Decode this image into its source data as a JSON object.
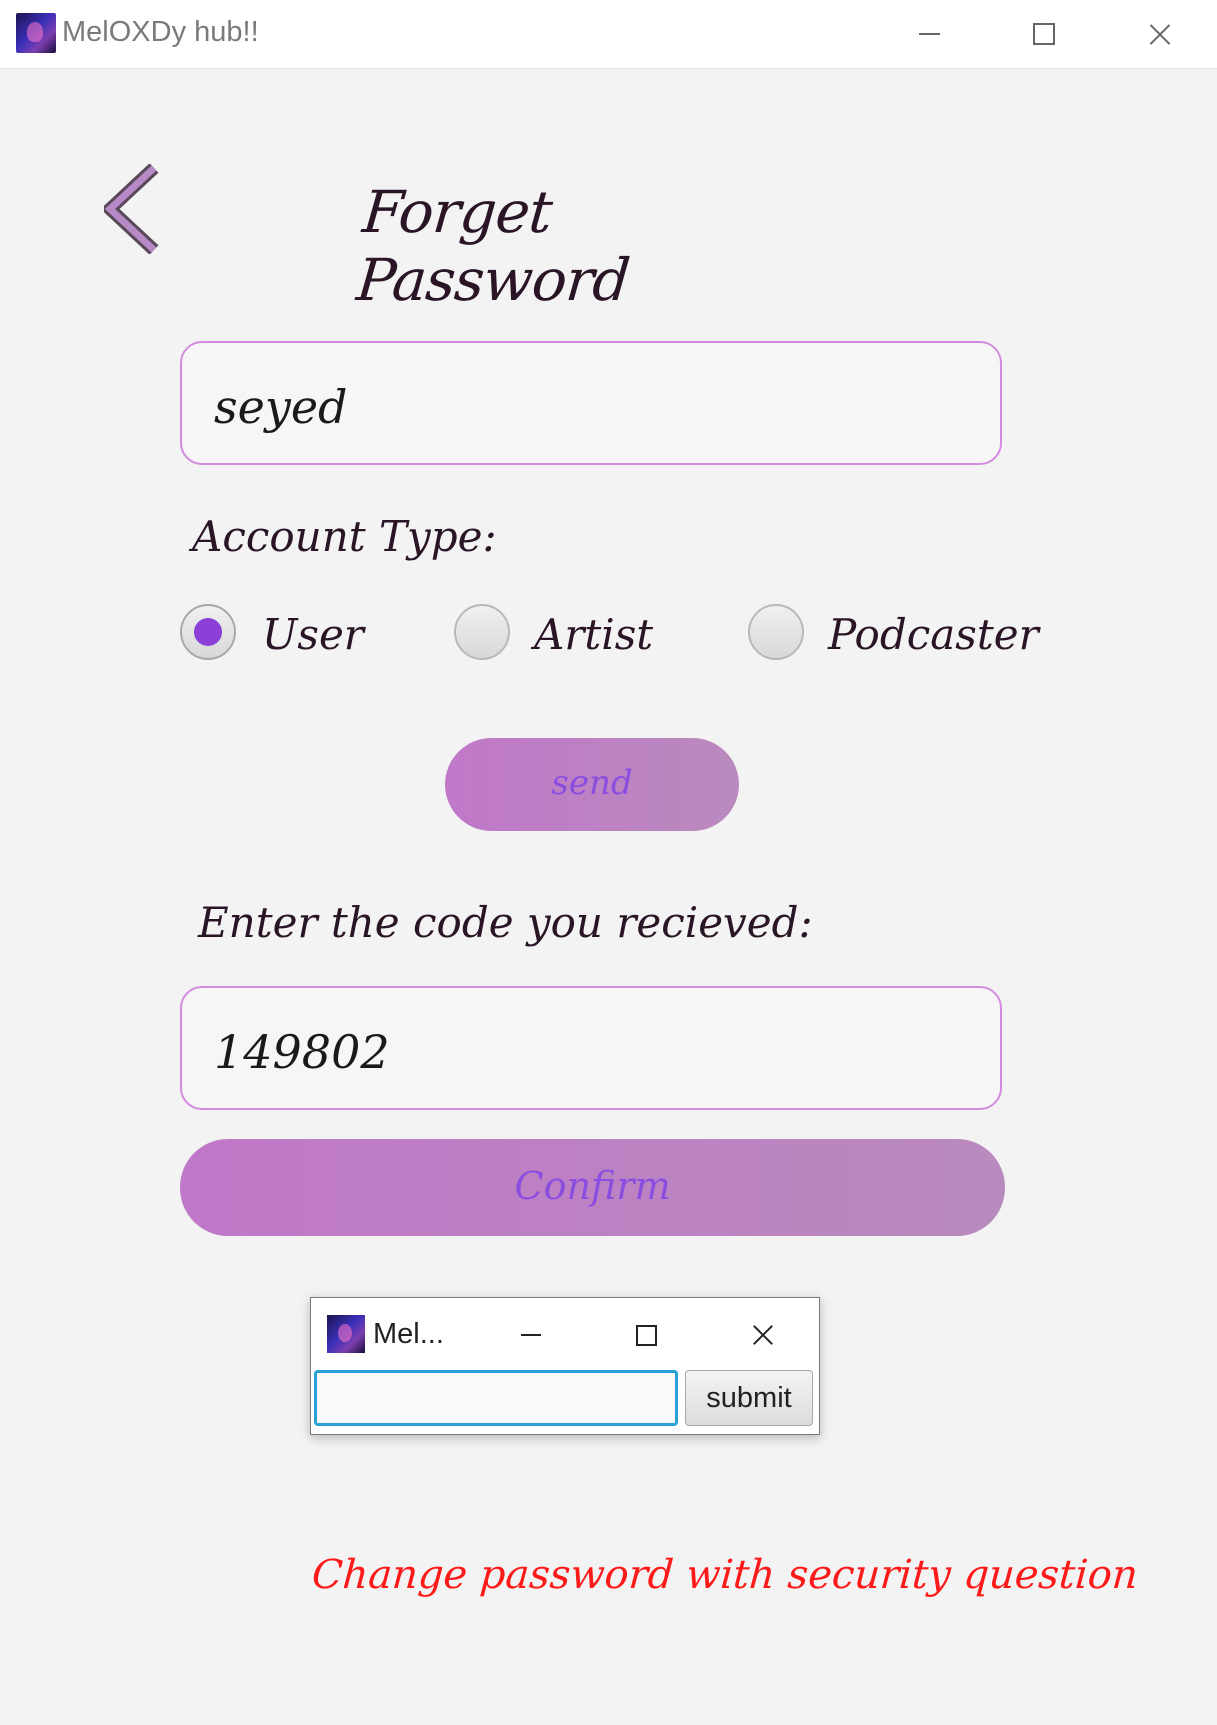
{
  "window": {
    "title": "MelOXDy hub!!"
  },
  "page": {
    "title": "Forget Password"
  },
  "form": {
    "username_value": "seyed",
    "account_type_label": "Account Type:",
    "account_types": [
      "User",
      "Artist",
      "Podcaster"
    ],
    "selected_account_type": "User",
    "send_label": "send",
    "code_label": "Enter the code you recieved:",
    "code_value": "149802",
    "confirm_label": "Confirm"
  },
  "dialog": {
    "title": "Mel...",
    "input_value": "",
    "submit_label": "submit"
  },
  "footer": {
    "security_link": "Change password with security question"
  },
  "colors": {
    "accent_purple": "#8a3fd8",
    "field_border": "#d38be0",
    "button_fill": "#c078c8",
    "link_red": "#ff1a1a"
  },
  "icons": [
    "app-logo",
    "minimize-icon",
    "maximize-icon",
    "close-icon",
    "back-chevron-icon"
  ]
}
